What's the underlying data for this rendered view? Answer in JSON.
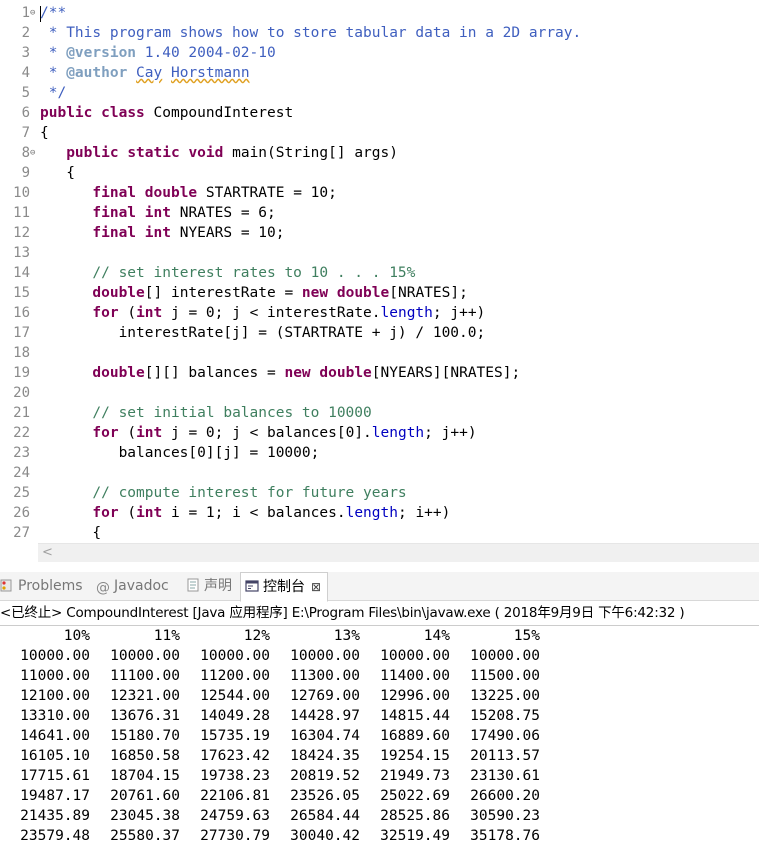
{
  "editor": {
    "line_numbers": [
      "1",
      "2",
      "3",
      "4",
      "5",
      "6",
      "7",
      "8",
      "9",
      "10",
      "11",
      "12",
      "13",
      "14",
      "15",
      "16",
      "17",
      "18",
      "19",
      "20",
      "21",
      "22",
      "23",
      "24",
      "25",
      "26",
      "27"
    ],
    "lines": [
      [
        {
          "t": "/**",
          "c": "jd"
        }
      ],
      [
        {
          "t": " * This program shows how to store tabular data in a 2D array.",
          "c": "jd"
        }
      ],
      [
        {
          "t": " * ",
          "c": "jd"
        },
        {
          "t": "@version",
          "c": "jt"
        },
        {
          "t": " 1.40 2004-02-10",
          "c": "jd"
        }
      ],
      [
        {
          "t": " * ",
          "c": "jd"
        },
        {
          "t": "@author",
          "c": "jt"
        },
        {
          "t": " ",
          "c": "jd"
        },
        {
          "t": "Cay",
          "c": "jd sq"
        },
        {
          "t": " ",
          "c": "jd"
        },
        {
          "t": "Horstmann",
          "c": "jd sq"
        }
      ],
      [
        {
          "t": " */",
          "c": "jd"
        }
      ],
      [
        {
          "t": "public",
          "c": "kw"
        },
        {
          "t": " "
        },
        {
          "t": "class",
          "c": "kw"
        },
        {
          "t": " CompoundInterest"
        }
      ],
      [
        {
          "t": "{"
        }
      ],
      [
        {
          "t": "   "
        },
        {
          "t": "public",
          "c": "kw"
        },
        {
          "t": " "
        },
        {
          "t": "static",
          "c": "kw"
        },
        {
          "t": " "
        },
        {
          "t": "void",
          "c": "kw"
        },
        {
          "t": " main(String[] args)"
        }
      ],
      [
        {
          "t": "   {"
        }
      ],
      [
        {
          "t": "      "
        },
        {
          "t": "final",
          "c": "kw"
        },
        {
          "t": " "
        },
        {
          "t": "double",
          "c": "kw"
        },
        {
          "t": " STARTRATE = 10;"
        }
      ],
      [
        {
          "t": "      "
        },
        {
          "t": "final",
          "c": "kw"
        },
        {
          "t": " "
        },
        {
          "t": "int",
          "c": "kw"
        },
        {
          "t": " NRATES = 6;"
        }
      ],
      [
        {
          "t": "      "
        },
        {
          "t": "final",
          "c": "kw"
        },
        {
          "t": " "
        },
        {
          "t": "int",
          "c": "kw"
        },
        {
          "t": " NYEARS = 10;"
        }
      ],
      [
        {
          "t": ""
        }
      ],
      [
        {
          "t": "      "
        },
        {
          "t": "// set interest rates to 10 . . . 15%",
          "c": "cm"
        }
      ],
      [
        {
          "t": "      "
        },
        {
          "t": "double",
          "c": "kw"
        },
        {
          "t": "[] interestRate = "
        },
        {
          "t": "new",
          "c": "kw"
        },
        {
          "t": " "
        },
        {
          "t": "double",
          "c": "kw"
        },
        {
          "t": "[NRATES];"
        }
      ],
      [
        {
          "t": "      "
        },
        {
          "t": "for",
          "c": "kw"
        },
        {
          "t": " ("
        },
        {
          "t": "int",
          "c": "kw"
        },
        {
          "t": " j = 0; j < interestRate."
        },
        {
          "t": "length",
          "c": "fld"
        },
        {
          "t": "; j++)"
        }
      ],
      [
        {
          "t": "         interestRate[j] = (STARTRATE + j) / 100.0;"
        }
      ],
      [
        {
          "t": ""
        }
      ],
      [
        {
          "t": "      "
        },
        {
          "t": "double",
          "c": "kw"
        },
        {
          "t": "[][] balances = "
        },
        {
          "t": "new",
          "c": "kw"
        },
        {
          "t": " "
        },
        {
          "t": "double",
          "c": "kw"
        },
        {
          "t": "[NYEARS][NRATES];"
        }
      ],
      [
        {
          "t": ""
        }
      ],
      [
        {
          "t": "      "
        },
        {
          "t": "// set initial balances to 10000",
          "c": "cm"
        }
      ],
      [
        {
          "t": "      "
        },
        {
          "t": "for",
          "c": "kw"
        },
        {
          "t": " ("
        },
        {
          "t": "int",
          "c": "kw"
        },
        {
          "t": " j = 0; j < balances[0]."
        },
        {
          "t": "length",
          "c": "fld"
        },
        {
          "t": "; j++)"
        }
      ],
      [
        {
          "t": "         balances[0][j] = 10000;"
        }
      ],
      [
        {
          "t": ""
        }
      ],
      [
        {
          "t": "      "
        },
        {
          "t": "// compute interest for future years",
          "c": "cm"
        }
      ],
      [
        {
          "t": "      "
        },
        {
          "t": "for",
          "c": "kw"
        },
        {
          "t": " ("
        },
        {
          "t": "int",
          "c": "kw"
        },
        {
          "t": " i = 1; i < balances."
        },
        {
          "t": "length",
          "c": "fld"
        },
        {
          "t": "; i++)"
        }
      ],
      [
        {
          "t": "      {"
        }
      ]
    ]
  },
  "tabs": [
    {
      "label": "Problems",
      "icon": "problems-icon"
    },
    {
      "label": "Javadoc",
      "icon": "javadoc-icon"
    },
    {
      "label": "声明",
      "icon": "declaration-icon"
    },
    {
      "label": "控制台",
      "icon": "console-icon",
      "close": "⊠"
    }
  ],
  "console": {
    "header": "<已终止> CompoundInterest [Java 应用程序] E:\\Program Files\\bin\\javaw.exe ( 2018年9月9日 下午6:42:32 )",
    "columns": [
      "10%",
      "11%",
      "12%",
      "13%",
      "14%",
      "15%"
    ],
    "rows": [
      [
        "10000.00",
        "10000.00",
        "10000.00",
        "10000.00",
        "10000.00",
        "10000.00"
      ],
      [
        "11000.00",
        "11100.00",
        "11200.00",
        "11300.00",
        "11400.00",
        "11500.00"
      ],
      [
        "12100.00",
        "12321.00",
        "12544.00",
        "12769.00",
        "12996.00",
        "13225.00"
      ],
      [
        "13310.00",
        "13676.31",
        "14049.28",
        "14428.97",
        "14815.44",
        "15208.75"
      ],
      [
        "14641.00",
        "15180.70",
        "15735.19",
        "16304.74",
        "16889.60",
        "17490.06"
      ],
      [
        "16105.10",
        "16850.58",
        "17623.42",
        "18424.35",
        "19254.15",
        "20113.57"
      ],
      [
        "17715.61",
        "18704.15",
        "19738.23",
        "20819.52",
        "21949.73",
        "23130.61"
      ],
      [
        "19487.17",
        "20761.60",
        "22106.81",
        "23526.05",
        "25022.69",
        "26600.20"
      ],
      [
        "21435.89",
        "23045.38",
        "24759.63",
        "26584.44",
        "28525.86",
        "30590.23"
      ],
      [
        "23579.48",
        "25580.37",
        "27730.79",
        "30040.42",
        "32519.49",
        "35178.76"
      ]
    ]
  }
}
